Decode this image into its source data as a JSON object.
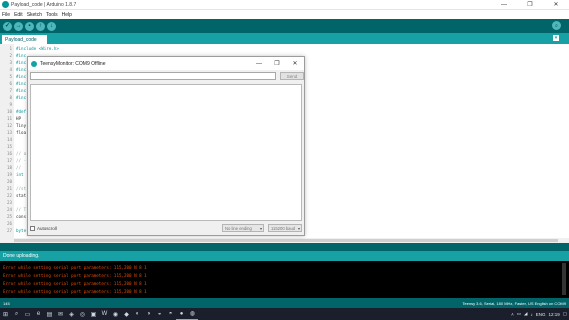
{
  "window": {
    "title": "Payload_code | Arduino 1.8.7",
    "minimize": "—",
    "maximize": "❐",
    "close": "✕"
  },
  "menu": [
    "File",
    "Edit",
    "Sketch",
    "Tools",
    "Help"
  ],
  "toolbar": {
    "verify_glyph": "✓",
    "upload_glyph": "→",
    "new_glyph": "▪",
    "open_glyph": "↑",
    "save_glyph": "↓",
    "monitor_glyph": "⌕"
  },
  "tab": {
    "label": "Payload_code",
    "menu_glyph": "▾"
  },
  "code_lines": [
    {
      "n": "1",
      "text": "#include <Wire.h>",
      "style": "kw"
    },
    {
      "n": "2",
      "text": "#inc",
      "style": "kw"
    },
    {
      "n": "3",
      "text": "#inc",
      "style": "kw"
    },
    {
      "n": "4",
      "text": "#inc",
      "style": "kw"
    },
    {
      "n": "5",
      "text": "#inc",
      "style": "kw"
    },
    {
      "n": "6",
      "text": "#inc",
      "style": "kw"
    },
    {
      "n": "7",
      "text": "#inc",
      "style": "kw"
    },
    {
      "n": "8",
      "text": "#inc",
      "style": "kw"
    },
    {
      "n": "9",
      "text": "",
      "style": ""
    },
    {
      "n": "10",
      "text": "#def",
      "style": "kw"
    },
    {
      "n": "11",
      "text": "HP",
      "style": ""
    },
    {
      "n": "12",
      "text": "Tiny",
      "style": ""
    },
    {
      "n": "13",
      "text": "floa",
      "style": ""
    },
    {
      "n": "14",
      "text": "",
      "style": ""
    },
    {
      "n": "15",
      "text": "",
      "style": ""
    },
    {
      "n": "16",
      "text": "// a",
      "style": "comment"
    },
    {
      "n": "17",
      "text": "// -",
      "style": "comment"
    },
    {
      "n": "18",
      "text": "//",
      "style": "comment"
    },
    {
      "n": "19",
      "text": "int",
      "style": "kw"
    },
    {
      "n": "20",
      "text": "",
      "style": ""
    },
    {
      "n": "21",
      "text": "//st",
      "style": "comment"
    },
    {
      "n": "22",
      "text": "stat",
      "style": ""
    },
    {
      "n": "23",
      "text": "",
      "style": ""
    },
    {
      "n": "24",
      "text": "// T",
      "style": "comment"
    },
    {
      "n": "25",
      "text": "cons",
      "style": ""
    },
    {
      "n": "26",
      "text": "",
      "style": ""
    },
    {
      "n": "27",
      "text": "byte high_1, high_2, low_1, low_2",
      "style": "kw"
    }
  ],
  "status": {
    "message": "Done uploading."
  },
  "console": {
    "lines": [
      "Error while setting serial port parameters: 115,200 N 8 1",
      "Error while setting serial port parameters: 115,200 N 8 1",
      "Error while setting serial port parameters: 115,200 N 8 1",
      "Error while setting serial port parameters: 115,200 N 8 1"
    ]
  },
  "footer": {
    "line_number": "145",
    "board_info": "Teensy 3.6, Serial, 180 MHz, Faster, US English on COM9"
  },
  "monitor": {
    "title": "TeensyMonitor: COM9 Offline",
    "send_label": "Send",
    "input_value": "",
    "autoscroll_label": "Autoscroll",
    "line_ending": "No line ending",
    "baud": "115200 baud",
    "dropdown_glyph": "▾"
  },
  "taskbar": {
    "start_glyph": "⊞",
    "search_glyph": "⌕",
    "task_view_glyph": "▭",
    "app_glyphs": [
      "e",
      "▤",
      "✉",
      "◈",
      "◎",
      "▣",
      "W",
      "◉",
      "◆",
      "◐",
      "◑",
      "◒",
      "◓",
      "●",
      "◍"
    ],
    "tray_glyphs": [
      "˄",
      "▭",
      "◢",
      "♪",
      "ENG"
    ],
    "time": "12:19",
    "notify_glyph": "▢"
  }
}
